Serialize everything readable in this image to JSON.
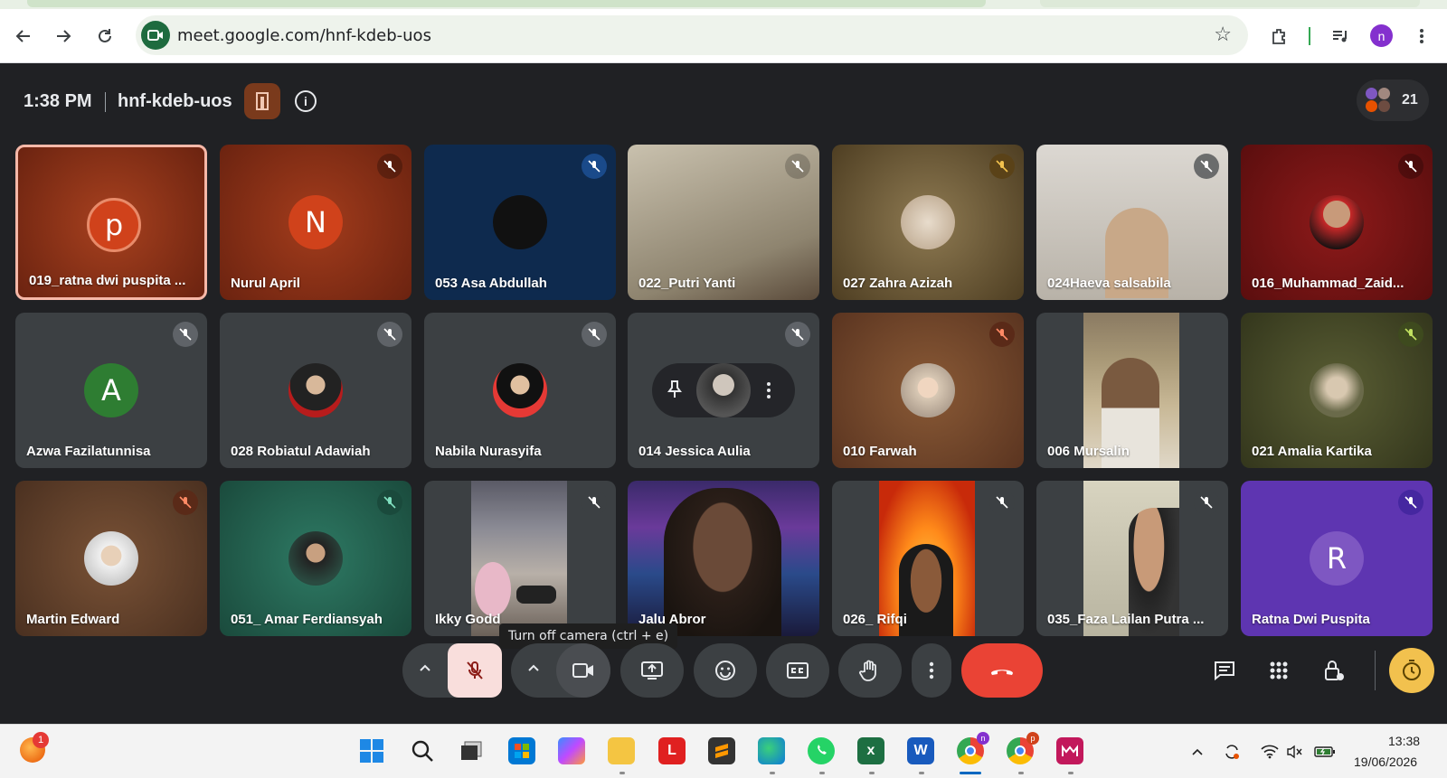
{
  "browser": {
    "url": "meet.google.com/hnf-kdeb-uos",
    "profile_initial": "n"
  },
  "meet": {
    "time": "1:38 PM",
    "code": "hnf-kdeb-uos",
    "participant_count": "21",
    "tooltip": "Turn off camera (ctrl + e)"
  },
  "tiles": [
    {
      "name": "019_ratna dwi puspita ...",
      "avatar_letter": "p",
      "bg": "#7a2a14",
      "avatar_bg": "#d0421b"
    },
    {
      "name": "Nurul April",
      "avatar_letter": "N",
      "bg": "#7a2614",
      "avatar_bg": "#d0421b"
    },
    {
      "name": "053 Asa Abdullah",
      "bg": "#0e2a4e"
    },
    {
      "name": "022_Putri Yanti",
      "bg": "#a39a88"
    },
    {
      "name": "027 Zahra Azizah",
      "bg": "#6e5a3a"
    },
    {
      "name": "024Haeva salsabila",
      "bg": "#c9c5bf"
    },
    {
      "name": "016_Muhammad_Zaid...",
      "bg": "#6e1414"
    },
    {
      "name": "Azwa Fazilatunnisa",
      "avatar_letter": "A",
      "bg": "#3c4043",
      "avatar_bg": "#2e7d32"
    },
    {
      "name": "028 Robiatul Adawiah",
      "bg": "#3c4043"
    },
    {
      "name": "Nabila Nurasyifa",
      "bg": "#3c4043"
    },
    {
      "name": "014 Jessica Aulia",
      "bg": "#3c4043"
    },
    {
      "name": "010 Farwah",
      "bg": "#6e4226"
    },
    {
      "name": "006 Mursalin",
      "bg": "#3c4043"
    },
    {
      "name": "021 Amalia Kartika",
      "bg": "#3f4424"
    },
    {
      "name": "Martin Edward",
      "bg": "#5a3a24"
    },
    {
      "name": "051_ Amar Ferdiansyah",
      "bg": "#1e5a4a"
    },
    {
      "name": "Ikky Godd",
      "bg": "#3c4043"
    },
    {
      "name": "Jalu Abror",
      "bg": "#2a2446"
    },
    {
      "name": "026_ Rifqi",
      "bg": "#3c4043"
    },
    {
      "name": "035_Faza Lailan Putra ...",
      "bg": "#3c4043"
    },
    {
      "name": "Ratna Dwi Puspita",
      "avatar_letter": "R",
      "bg": "#5e35b1",
      "avatar_bg": "#7e57c2"
    }
  ],
  "controls": {
    "mic_state": "muted",
    "camera_state": "on",
    "end_call_color": "#ea4335"
  },
  "taskbar": {
    "notification_badge": "1",
    "clock_time": "13:38",
    "clock_date": "19/06/2026",
    "apps": [
      "windows-start",
      "search",
      "task-view",
      "microsoft-store",
      "copilot",
      "file-explorer",
      "app-l",
      "sublime-text",
      "edge",
      "whatsapp",
      "excel",
      "word",
      "chrome-n",
      "chrome-p",
      "app-red"
    ]
  }
}
